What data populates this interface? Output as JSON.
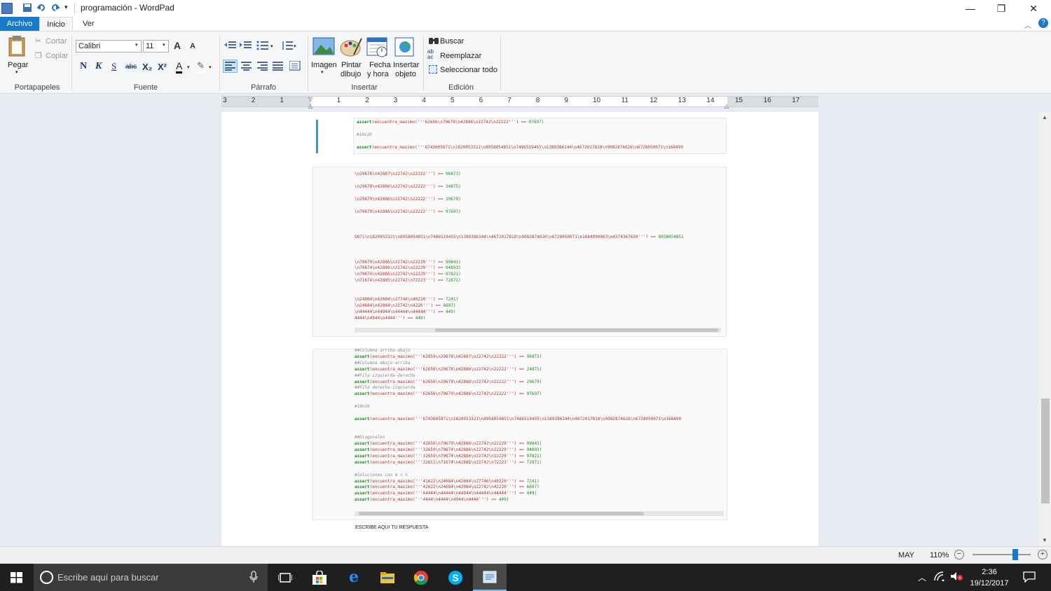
{
  "window": {
    "title": "programación - WordPad",
    "minimize": "—",
    "maximize": "❐",
    "close": "✕"
  },
  "qat": {
    "customize": "▾"
  },
  "tabs": [
    {
      "label": "Archivo"
    },
    {
      "label": "Inicio"
    },
    {
      "label": "Ver"
    }
  ],
  "ribbon": {
    "clipboard": {
      "paste": "Pegar",
      "cut": "Cortar",
      "copy": "Copiar",
      "label": "Portapapeles"
    },
    "font": {
      "family": "Calibri",
      "size": "11",
      "label": "Fuente",
      "bold": "N",
      "italic": "K",
      "underline": "S",
      "strike": "abc",
      "sub": "X₂",
      "sup": "X²",
      "grow": "A",
      "shrink": "A",
      "color": "A"
    },
    "paragraph": {
      "label": "Párrafo"
    },
    "insert": {
      "image": "Imagen",
      "paint1": "Pintar",
      "paint2": "dibujo",
      "date1": "Fecha",
      "date2": "y hora",
      "obj1": "Insertar",
      "obj2": "objeto",
      "label": "Insertar"
    },
    "editing": {
      "find": "Buscar",
      "replace": "Reemplazar",
      "selectall": "Seleccionar todo",
      "label": "Edición"
    }
  },
  "ruler": {
    "marks": [
      "3",
      "2",
      "1",
      "1",
      "2",
      "3",
      "4",
      "5",
      "6",
      "7",
      "8",
      "9",
      "10",
      "11",
      "12",
      "13",
      "14",
      "15",
      "16",
      "17"
    ]
  },
  "doc": {
    "block1": [
      {
        "kw": "assert",
        "body": "(encuentra_maximo('''62656\\n79679\\n42886\\n22742\\n22222''') == ",
        "num": "97697)"
      },
      {
        "cm": "#10x10"
      },
      {
        "kw": "assert",
        "body": "(encuentra_maximo('''6743605871\\n1820953321\\n8958054851\\n7486519455\\n1389386144\\n4672017818\\n9082874626\\n6728050071\\n168499",
        "num": ""
      }
    ],
    "block2": [
      {
        "body": "\\n29678\\n42887\\n22742\\n22322''') == ",
        "num": "96873)"
      },
      {
        "body": "\\n29678\\n42886\\n22742\\n22222''') == ",
        "num": "24875)"
      },
      {
        "body": "\\n29679\\n42886\\n22742\\n22222''') == ",
        "num": "29679)"
      },
      {
        "body": "\\n79679\\n42886\\n22742\\n22222''') == ",
        "num": "97697)"
      },
      {
        "body": "5871\\n1820953321\\n8958054851\\n7486519455\\n1389386144\\n4672017818\\n9082874626\\n6728050071\\n1684990063\\n4374367650''') == ",
        "num": "8958054851"
      },
      {
        "body": "\\n79679\\n42886\\n22742\\n22229''') == ",
        "num": "99841)"
      },
      {
        "body": "\\n79674\\n42886\\n22742\\n22229''') == ",
        "num": "94893)"
      },
      {
        "body": "\\n79674\\n42886\\n22742\\n12229''') == ",
        "num": "97821)"
      },
      {
        "body": "\\n71674\\n42885\\n22742\\n72223''') == ",
        "num": "72871)"
      },
      {
        "body": "\\n24084\\n42084\\n27746\\n40220''') == ",
        "num": "7241)"
      },
      {
        "body": "\\n24684\\n42084\\n22742\\n4220''') == ",
        "num": "6607)"
      },
      {
        "body": "\\n44444\\n44944\\n44444\\n44444''') == ",
        "num": "449)"
      },
      {
        "body": "4444\\n4944\\n4444''') == ",
        "num": "449)"
      }
    ],
    "block3": [
      {
        "cm": "##Columna arriba-abajo"
      },
      {
        "kw": "assert",
        "body": "(encuentra_maximo('''62959\\n29678\\n42887\\n22742\\n22322''') == ",
        "num": "96873)"
      },
      {
        "cm": "##Columna abajo-arriba"
      },
      {
        "kw": "assert",
        "body": "(encuentra_maximo('''62656\\n29678\\n42886\\n22742\\n22222''') == ",
        "num": "24875)"
      },
      {
        "cm": "##Fila izquierda-derecha"
      },
      {
        "kw": "assert",
        "body": "(encuentra_maximo('''62656\\n29679\\n42886\\n22742\\n22222''') == ",
        "num": "29679)"
      },
      {
        "cm": "##Fila derecha-izquierda"
      },
      {
        "kw": "assert",
        "body": "(encuentra_maximo('''62656\\n79679\\n42886\\n22742\\n22222''') == ",
        "num": "97697)"
      },
      {
        "cm": "#10x10"
      },
      {
        "kw": "assert",
        "body": "(encuentra_maximo('''6743605871\\n1820953321\\n8958054851\\n7486519455\\n1389386144\\n4672017818\\n9082874626\\n6728050071\\n168499",
        "num": ""
      },
      {
        "cm": "##Diagonales"
      },
      {
        "kw": "assert",
        "body": "(encuentra_maximo('''42656\\n79679\\n42886\\n22742\\n22229''') == ",
        "num": "99841)"
      },
      {
        "kw": "assert",
        "body": "(encuentra_maximo('''32659\\n79674\\n42886\\n22742\\n22229''') == ",
        "num": "94893)"
      },
      {
        "kw": "assert",
        "body": "(encuentra_maximo('''32659\\n79674\\n42886\\n22742\\n12229''') == ",
        "num": "97821)"
      },
      {
        "kw": "assert",
        "body": "(encuentra_maximo('''32651\\n71674\\n42885\\n22742\\n72223''') == ",
        "num": "72871)"
      },
      {
        "cm": "#Soluciones con m < n"
      },
      {
        "kw": "assert",
        "body": "(encuentra_maximo('''41622\\n24084\\n42084\\n27746\\n40220''') == ",
        "num": "7241)"
      },
      {
        "kw": "assert",
        "body": "(encuentra_maximo('''42622\\n24684\\n42084\\n22742\\n42220''') == ",
        "num": "6607)"
      },
      {
        "kw": "assert",
        "body": "(encuentra_maximo('''44444\\n44444\\n44944\\n44444\\n44444''') == ",
        "num": "449)"
      },
      {
        "kw": "assert",
        "body": "(encuentra_maximo('''4444\\n4444\\n4944\\n4444''') == ",
        "num": "449)"
      }
    ],
    "answer": "ESCRIBE AQUI TU RESPUESTA"
  },
  "status": {
    "caps": "MAY",
    "zoom": "110%",
    "zoom_level": 0.74
  },
  "taskbar": {
    "search_placeholder": "Escribe aquí para buscar",
    "time": "2:36",
    "date": "19/12/2017"
  }
}
